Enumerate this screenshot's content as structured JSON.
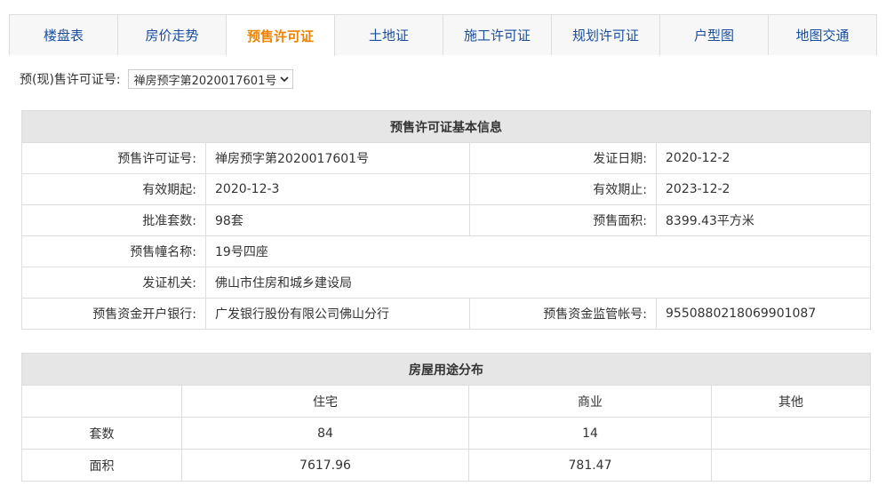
{
  "tabs": [
    "楼盘表",
    "房价走势",
    "预售许可证",
    "土地证",
    "施工许可证",
    "规划许可证",
    "户型图",
    "地图交通"
  ],
  "active_tab": 2,
  "permit_selector": {
    "label": "预(现)售许可证号:",
    "selected": "禅房预字第2020017601号"
  },
  "basic_info": {
    "title": "预售许可证基本信息",
    "rows": [
      {
        "label1": "预售许可证号:",
        "value1": "禅房预字第2020017601号",
        "label2": "发证日期:",
        "value2": "2020-12-2"
      },
      {
        "label1": "有效期起:",
        "value1": "2020-12-3",
        "label2": "有效期止:",
        "value2": "2023-12-2"
      },
      {
        "label1": "批准套数:",
        "value1": "98套",
        "label2": "预售面积:",
        "value2": "8399.43平方米"
      },
      {
        "label1": "预售幢名称:",
        "value1": "19号四座"
      },
      {
        "label1": "发证机关:",
        "value1": "佛山市住房和城乡建设局"
      },
      {
        "label1": "预售资金开户银行:",
        "value1": "广发银行股份有限公司佛山分行",
        "label2": "预售资金监管帐号:",
        "value2": "9550880218069901087"
      }
    ]
  },
  "usage": {
    "title": "房屋用途分布",
    "columns": [
      "",
      "住宅",
      "商业",
      "其他"
    ],
    "rows": [
      {
        "label": "套数",
        "values": [
          "84",
          "14",
          ""
        ]
      },
      {
        "label": "面积",
        "values": [
          "7617.96",
          "781.47",
          ""
        ]
      }
    ]
  }
}
